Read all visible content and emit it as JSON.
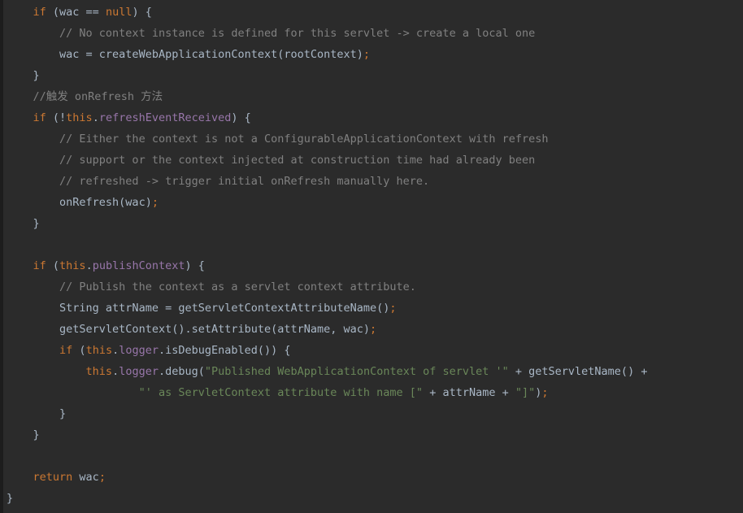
{
  "editor": {
    "language": "java",
    "theme": "darcula",
    "background_color": "#2b2b2b",
    "gutter_color": "#1d1d1d",
    "colors": {
      "keyword": "#cc7832",
      "comment": "#808080",
      "field": "#9876aa",
      "string": "#6a8759",
      "identifier": "#a9b7c6",
      "semicolon": "#cc7832"
    }
  },
  "code": {
    "lines": [
      {
        "indent": 1,
        "tokens": [
          {
            "t": "if",
            "c": "kw"
          },
          {
            "t": " (wac == ",
            "c": "id"
          },
          {
            "t": "null",
            "c": "kw"
          },
          {
            "t": ") {",
            "c": "id"
          }
        ]
      },
      {
        "indent": 2,
        "tokens": [
          {
            "t": "// No context instance is defined for this servlet -> create a local one",
            "c": "cmt"
          }
        ]
      },
      {
        "indent": 2,
        "tokens": [
          {
            "t": "wac = createWebApplicationContext(rootContext",
            "c": "id"
          },
          {
            "t": ")",
            "c": "punct"
          },
          {
            "t": ";",
            "c": "semi"
          }
        ]
      },
      {
        "indent": 1,
        "tokens": [
          {
            "t": "}",
            "c": "id"
          }
        ]
      },
      {
        "indent": 1,
        "tokens": [
          {
            "t": "//触发 onRefresh 方法",
            "c": "cmt"
          }
        ]
      },
      {
        "indent": 1,
        "tokens": [
          {
            "t": "if",
            "c": "kw"
          },
          {
            "t": " (!",
            "c": "id"
          },
          {
            "t": "this",
            "c": "kw"
          },
          {
            "t": ".",
            "c": "id"
          },
          {
            "t": "refreshEventReceived",
            "c": "fld"
          },
          {
            "t": ") {",
            "c": "id"
          }
        ]
      },
      {
        "indent": 2,
        "tokens": [
          {
            "t": "// Either the context is not a ConfigurableApplicationContext with refresh",
            "c": "cmt"
          }
        ]
      },
      {
        "indent": 2,
        "tokens": [
          {
            "t": "// support or the context injected at construction time had already been",
            "c": "cmt"
          }
        ]
      },
      {
        "indent": 2,
        "tokens": [
          {
            "t": "// refreshed -> trigger initial onRefresh manually here.",
            "c": "cmt"
          }
        ]
      },
      {
        "indent": 2,
        "tokens": [
          {
            "t": "onRefresh(wac)",
            "c": "mth"
          },
          {
            "t": ";",
            "c": "semi"
          }
        ]
      },
      {
        "indent": 1,
        "tokens": [
          {
            "t": "}",
            "c": "id"
          }
        ]
      },
      {
        "indent": 0,
        "tokens": []
      },
      {
        "indent": 1,
        "tokens": [
          {
            "t": "if",
            "c": "kw"
          },
          {
            "t": " (",
            "c": "id"
          },
          {
            "t": "this",
            "c": "kw"
          },
          {
            "t": ".",
            "c": "id"
          },
          {
            "t": "publishContext",
            "c": "fld"
          },
          {
            "t": ") {",
            "c": "id"
          }
        ]
      },
      {
        "indent": 2,
        "tokens": [
          {
            "t": "// Publish the context as a servlet context attribute.",
            "c": "cmt"
          }
        ]
      },
      {
        "indent": 2,
        "tokens": [
          {
            "t": "String attrName = getServletContextAttributeName()",
            "c": "id"
          },
          {
            "t": ";",
            "c": "semi"
          }
        ]
      },
      {
        "indent": 2,
        "tokens": [
          {
            "t": "getServletContext().setAttribute(attrName, wac)",
            "c": "id"
          },
          {
            "t": ";",
            "c": "semi"
          }
        ]
      },
      {
        "indent": 2,
        "tokens": [
          {
            "t": "if",
            "c": "kw"
          },
          {
            "t": " (",
            "c": "id"
          },
          {
            "t": "this",
            "c": "kw"
          },
          {
            "t": ".",
            "c": "id"
          },
          {
            "t": "logger",
            "c": "fld"
          },
          {
            "t": ".isDebugEnabled()) {",
            "c": "id"
          }
        ]
      },
      {
        "indent": 3,
        "tokens": [
          {
            "t": "this",
            "c": "kw"
          },
          {
            "t": ".",
            "c": "id"
          },
          {
            "t": "logger",
            "c": "fld"
          },
          {
            "t": ".debug(",
            "c": "id"
          },
          {
            "t": "\"Published WebApplicationContext of servlet '\"",
            "c": "str"
          },
          {
            "t": " + getServletName() +",
            "c": "id"
          }
        ]
      },
      {
        "indent": 5,
        "tokens": [
          {
            "t": "\"' as ServletContext attribute with name [\"",
            "c": "str"
          },
          {
            "t": " + attrName + ",
            "c": "id"
          },
          {
            "t": "\"]\"",
            "c": "str"
          },
          {
            "t": ")",
            "c": "punct"
          },
          {
            "t": ";",
            "c": "semi"
          }
        ]
      },
      {
        "indent": 2,
        "tokens": [
          {
            "t": "}",
            "c": "id"
          }
        ]
      },
      {
        "indent": 1,
        "tokens": [
          {
            "t": "}",
            "c": "id"
          }
        ]
      },
      {
        "indent": 0,
        "tokens": []
      },
      {
        "indent": 1,
        "tokens": [
          {
            "t": "return",
            "c": "kw"
          },
          {
            "t": " wac",
            "c": "id"
          },
          {
            "t": ";",
            "c": "semi"
          }
        ]
      },
      {
        "indent": 0,
        "tokens": [
          {
            "t": "}",
            "c": "id"
          }
        ]
      }
    ]
  }
}
